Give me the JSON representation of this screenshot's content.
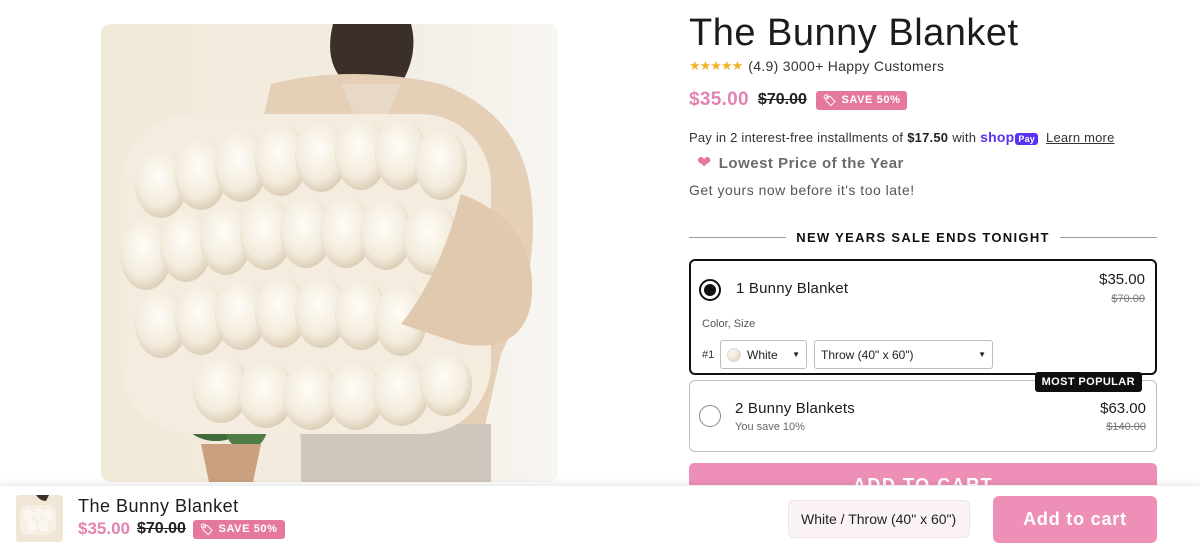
{
  "product": {
    "title": "The Bunny Blanket",
    "rating_stars": "★★★★★",
    "rating_text": "(4.9) 3000+ Happy Customers",
    "price": "$35.00",
    "compare_price": "$70.00",
    "save_label": "SAVE 50%"
  },
  "installments": {
    "prefix": "Pay in 2 interest-free installments of",
    "amount": "$17.50",
    "with": "with",
    "shop_logo": "shop",
    "pay_pill": "Pay",
    "learn_more": "Learn more"
  },
  "promo": {
    "lowest_price": "Lowest Price of the Year",
    "urgency": "Get yours now before it's too late!",
    "sale_banner": "NEW YEARS SALE ENDS TONIGHT"
  },
  "bundles": [
    {
      "label": "1 Bunny Blanket",
      "price": "$35.00",
      "compare": "$70.00",
      "selected": true,
      "variant_caption": "Color, Size",
      "variant_index": "#1",
      "color_value": "White",
      "size_value": "Throw (40\" x 60\")"
    },
    {
      "label": "2 Bunny Blankets",
      "sub": "You save 10%",
      "price": "$63.00",
      "compare": "$140.00",
      "selected": false,
      "badge": "MOST POPULAR"
    }
  ],
  "add_to_cart_label": "ADD TO CART",
  "sticky": {
    "title": "The Bunny Blanket",
    "price": "$35.00",
    "compare": "$70.00",
    "save_label": "SAVE 50%",
    "variant_value": "White / Throw (40\" x 60\")",
    "add_label": "Add to cart"
  },
  "colors": {
    "accent_pink": "#e383b3",
    "button_pink": "#ee8fb7",
    "badge_pink": "#e4789f",
    "shop_purple": "#5a31f4",
    "star_gold": "#f1b22c"
  },
  "icons": {
    "tag": "tag-icon",
    "heart": "heart-icon",
    "caret": "chevron-down-icon"
  }
}
